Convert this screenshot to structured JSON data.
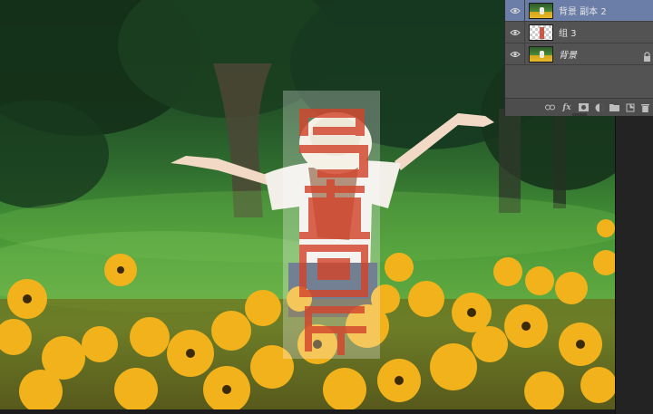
{
  "layers_panel": {
    "layers": [
      {
        "name": "背景 副本 2",
        "visible": true,
        "selected": true,
        "thumbnail": "photo",
        "italic": false,
        "locked": false
      },
      {
        "name": "组 3",
        "visible": true,
        "selected": false,
        "thumbnail": "group-transparent",
        "italic": false,
        "locked": false
      },
      {
        "name": "背景",
        "visible": true,
        "selected": false,
        "thumbnail": "photo",
        "italic": true,
        "locked": true
      }
    ],
    "footer_icons": [
      "link-icon",
      "fx-icon",
      "mask-icon",
      "adjustment-icon",
      "folder-icon",
      "new-layer-icon",
      "trash-icon"
    ],
    "fx_label": "fx",
    "selected_color": "#6b7ea8",
    "panel_color": "#535353"
  },
  "canvas": {
    "watermark_color": "#d2452c",
    "watermark_overlay": "#ffffff",
    "flower_color": "#f2b21b"
  }
}
